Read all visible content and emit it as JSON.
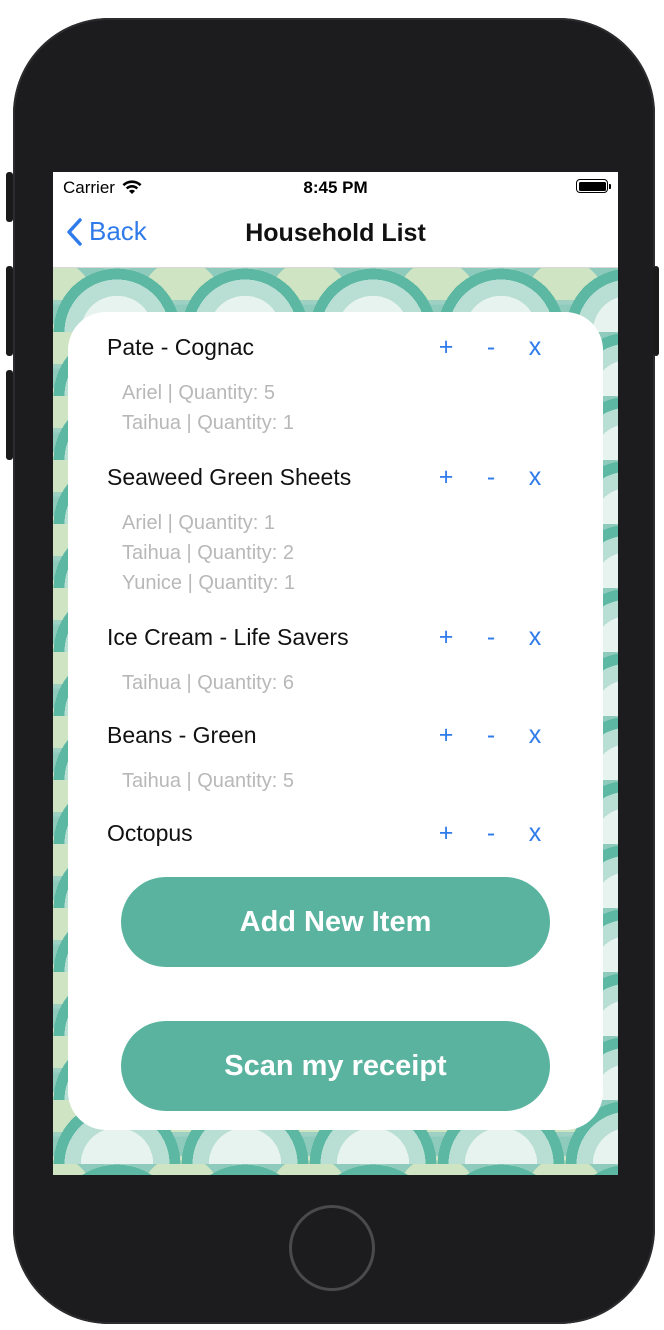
{
  "status_bar": {
    "carrier": "Carrier",
    "time": "8:45 PM"
  },
  "nav": {
    "back_label": "Back",
    "title": "Household List"
  },
  "controls": {
    "plus": "+",
    "minus": "-",
    "remove": "x"
  },
  "items": [
    {
      "name": "Pate - Cognac",
      "details": [
        "Ariel | Quantity: 5",
        "Taihua | Quantity: 1"
      ]
    },
    {
      "name": "Seaweed Green Sheets",
      "details": [
        "Ariel | Quantity: 1",
        "Taihua | Quantity: 2",
        "Yunice | Quantity: 1"
      ]
    },
    {
      "name": "Ice Cream - Life Savers",
      "details": [
        "Taihua | Quantity: 6"
      ]
    },
    {
      "name": "Beans - Green",
      "details": [
        "Taihua | Quantity: 5"
      ]
    },
    {
      "name": "Octopus",
      "details": []
    }
  ],
  "buttons": {
    "add_item": "Add New Item",
    "scan_receipt": "Scan my receipt"
  },
  "colors": {
    "accent": "#2f7bea",
    "button": "#5ab39e",
    "detail_text": "#b8b8b8"
  }
}
